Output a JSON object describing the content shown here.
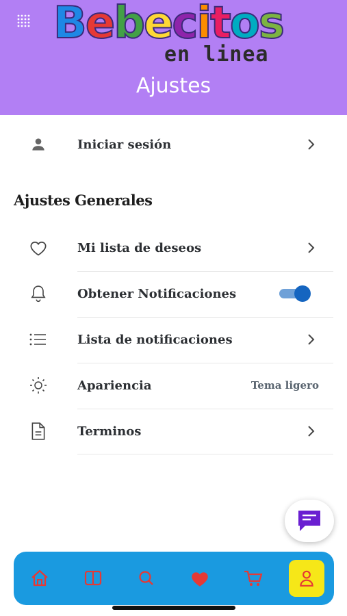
{
  "header": {
    "logo_main": "Bebecitos",
    "logo_sub": "en linea",
    "title": "Ajustes",
    "logo_colors": [
      "#1e88e5",
      "#e53935",
      "#43a047",
      "#fdd835",
      "#8e24aa",
      "#fb8c00",
      "#e91e63",
      "#00acc1",
      "#7cb342"
    ]
  },
  "account": {
    "login_label": "Iniciar sesión",
    "login_icon": "person-icon"
  },
  "general": {
    "section_title": "Ajustes Generales",
    "items": [
      {
        "label": "Mi lista de deseos",
        "icon": "heart-outline-icon",
        "control": "chevron"
      },
      {
        "label": "Obtener Notificaciones",
        "icon": "bell-icon",
        "control": "toggle",
        "toggle_on": true
      },
      {
        "label": "Lista de notificaciones",
        "icon": "list-icon",
        "control": "chevron"
      },
      {
        "label": "Apariencia",
        "icon": "sun-icon",
        "control": "value",
        "value": "Tema ligero"
      },
      {
        "label": "Terminos",
        "icon": "document-icon",
        "control": "chevron"
      }
    ]
  },
  "chat_fab": {
    "icon": "chat-icon"
  },
  "bottom_nav": {
    "items": [
      {
        "icon": "home-icon"
      },
      {
        "icon": "catalog-icon"
      },
      {
        "icon": "search-icon"
      },
      {
        "icon": "heart-filled-icon"
      },
      {
        "icon": "cart-icon"
      },
      {
        "icon": "profile-icon",
        "active": true
      }
    ]
  },
  "colors": {
    "header_bg": "#b27ff4",
    "nav_bg": "#1a9ae0",
    "nav_icon": "#e53935",
    "active_bg": "#f6e718",
    "toggle_on": "#1565c0",
    "fab_icon": "#6a1fd1"
  }
}
